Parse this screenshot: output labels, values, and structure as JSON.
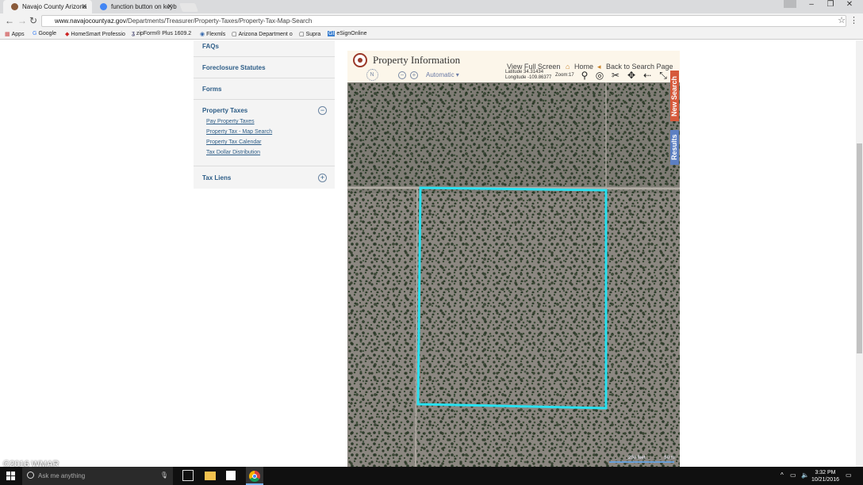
{
  "browser": {
    "tabs": [
      {
        "title": "Navajo County Arizona"
      },
      {
        "title": "function button on keyb"
      }
    ],
    "url_host": "www.navajocountyaz.gov",
    "url_path": "/Departments/Treasurer/Property-Taxes/Property-Tax-Map-Search",
    "bookmarks": [
      "Apps",
      "Google",
      "HomeSmart Professio",
      "zipForm® Plus 1609.2",
      "Flexmls",
      "Arizona Department o",
      "Supra",
      "eSignOnline"
    ]
  },
  "sidebar": {
    "items": [
      "FAQs",
      "Foreclosure Statutes",
      "Forms",
      "Property Taxes",
      "Tax Liens"
    ],
    "property_taxes_sub": [
      "Pay Property Taxes",
      "Property Tax - Map Search",
      "Property Tax Calendar",
      "Tax Dollar Distribution"
    ],
    "collapse_symbol": "−",
    "expand_symbol": "+"
  },
  "map": {
    "title": "Property Information",
    "view_full_screen": "View Full Screen",
    "home": "Home",
    "back": "Back to Search Page",
    "latitude": "Latitude  34.31434",
    "longitude": "Longitude  -109.86377",
    "zoom": "Zoom:17",
    "compass_letter": "N",
    "basemap_select": "Automatic",
    "new_search_tab": "New Search",
    "results_tab": "Results",
    "scale_feet": "250 feet",
    "scale_m": "50 m",
    "colors": {
      "parcel": "#29e1f0",
      "new_search": "#d6593b",
      "results": "#5c7fc2"
    }
  },
  "watermark": "©2016 WMAR",
  "taskbar": {
    "search_placeholder": "Ask me anything",
    "time": "3:32 PM",
    "date": "10/21/2016"
  }
}
